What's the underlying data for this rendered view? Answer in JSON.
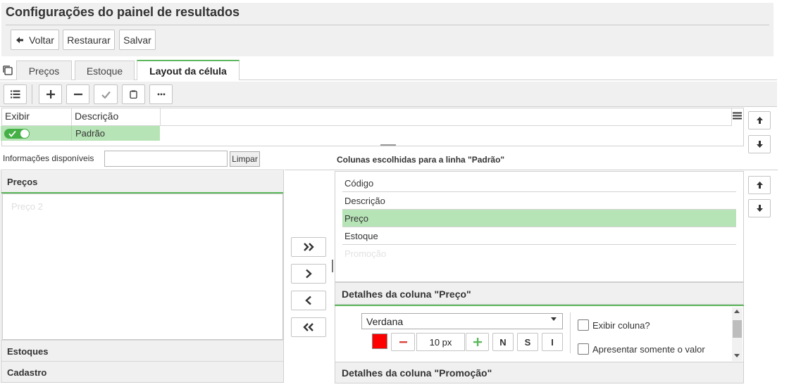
{
  "header": {
    "title": "Configurações do painel de resultados",
    "back_label": "Voltar",
    "restore_label": "Restaurar",
    "save_label": "Salvar"
  },
  "tabs": [
    {
      "label": "Preços",
      "active": false
    },
    {
      "label": "Estoque",
      "active": false
    },
    {
      "label": "Layout da célula",
      "active": true
    }
  ],
  "toolbar": {
    "icons": [
      "list-icon",
      "plus-icon",
      "minus-icon",
      "check-icon",
      "copy-icon",
      "more-icon"
    ]
  },
  "grid": {
    "columns": [
      "Exibir",
      "Descrição"
    ],
    "rows": [
      {
        "exibir": true,
        "descricao": "Padrão"
      }
    ]
  },
  "available": {
    "label": "Informações disponíveis",
    "filter_value": "",
    "clear_label": "Limpar",
    "sections": [
      {
        "title": "Preços",
        "items": [
          "Preço 2"
        ]
      },
      {
        "title": "Estoques"
      },
      {
        "title": "Cadastro"
      }
    ]
  },
  "chosen": {
    "label": "Colunas escolhidas para a linha \"Padrão\"",
    "items": [
      "Código",
      "Descrição",
      "Preço",
      "Estoque",
      "Promoção"
    ],
    "selected": "Preço"
  },
  "details": {
    "title": "Detalhes da coluna \"Preço\"",
    "font": "Verdana",
    "color": "#ff0000",
    "size": "10 px",
    "bold_label": "N",
    "strike_label": "S",
    "italic_label": "I",
    "show_column_label": "Exibir coluna?",
    "only_value_label": "Apresentar somente o valor",
    "next_title": "Detalhes da coluna \"Promoção\""
  },
  "colors": {
    "accent": "#5cb85c",
    "selected_row": "#b7e4b7",
    "panel_bg": "#f0f0f0"
  }
}
